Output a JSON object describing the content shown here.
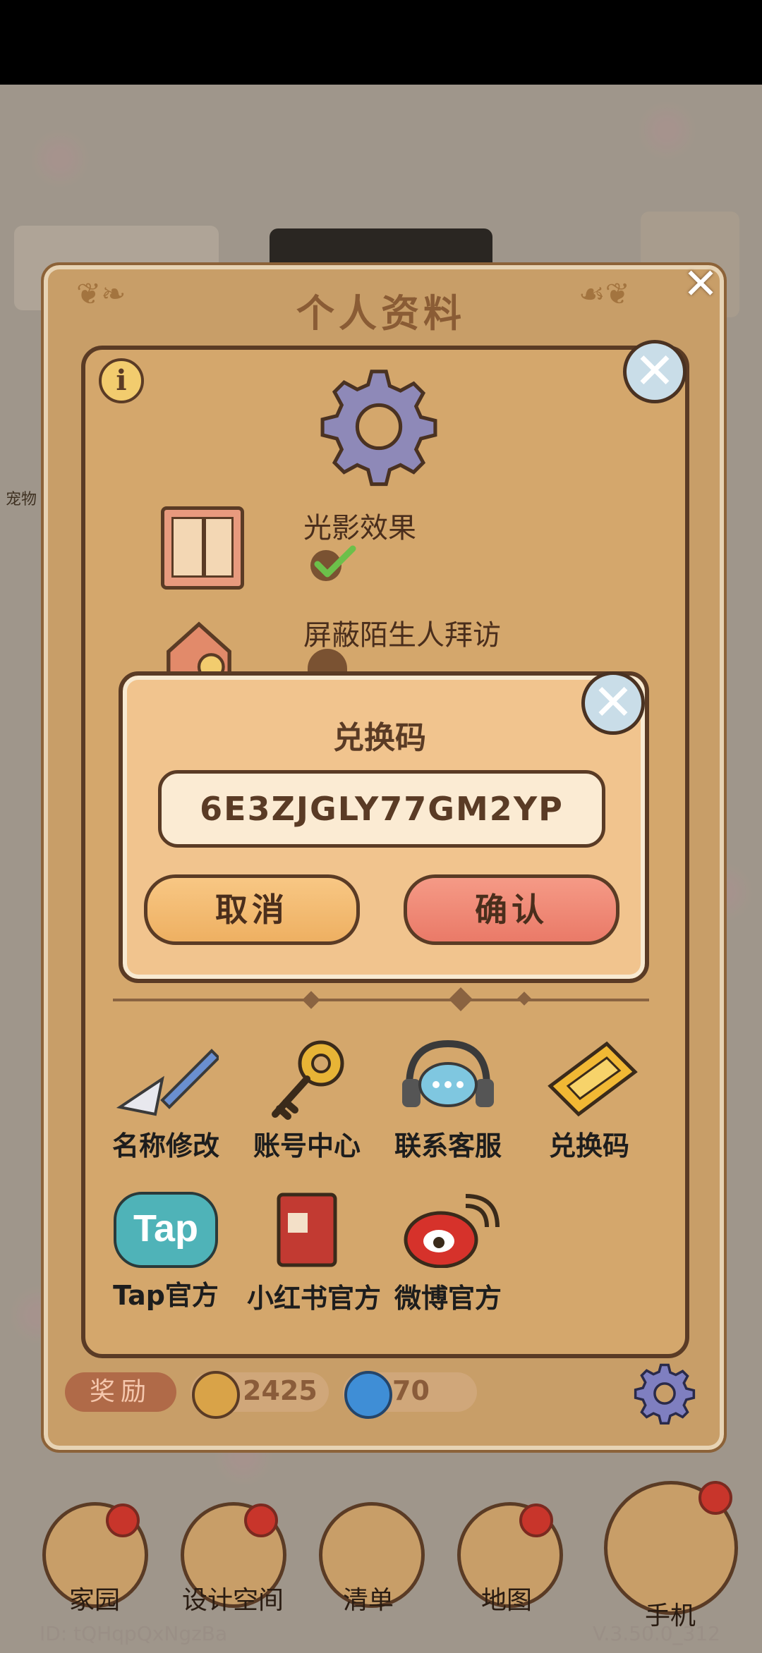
{
  "profile": {
    "title": "个人资料",
    "settings": [
      {
        "label": "光影效果",
        "checked": true
      },
      {
        "label": "屏蔽陌生人拜访",
        "checked": false
      }
    ],
    "tools": [
      {
        "label": "名称修改",
        "icon": "pencil-icon"
      },
      {
        "label": "账号中心",
        "icon": "key-icon"
      },
      {
        "label": "联系客服",
        "icon": "headset-chat-icon"
      },
      {
        "label": "兑换码",
        "icon": "ticket-icon"
      },
      {
        "label": "Tap官方",
        "icon": "tap-logo-icon"
      },
      {
        "label": "小红书官方",
        "icon": "red-book-icon"
      },
      {
        "label": "微博官方",
        "icon": "weibo-icon"
      }
    ],
    "tap_logo_text": "Tap",
    "footer": {
      "reward_label": "奖励",
      "coins": "2425",
      "gems": "70"
    }
  },
  "redeem": {
    "title": "兑换码",
    "code_value": "6E3ZJGLY77GM2YP",
    "cancel_label": "取消",
    "confirm_label": "确认"
  },
  "nav": [
    {
      "label": "家园"
    },
    {
      "label": "设计空间"
    },
    {
      "label": "清单"
    },
    {
      "label": "地图"
    },
    {
      "label": "手机"
    }
  ],
  "side": {
    "pet_label": "宠物"
  },
  "bottom": {
    "id_text": "ID: tQHqpQxNgzBa",
    "version": "V.3.50.0_312"
  },
  "colors": {
    "panel": "#c89e68",
    "card": "#d4a76c",
    "modal": "#f1c48e",
    "confirm": "#ea7a68",
    "cancel": "#eeb062",
    "outline": "#5a3b25"
  }
}
